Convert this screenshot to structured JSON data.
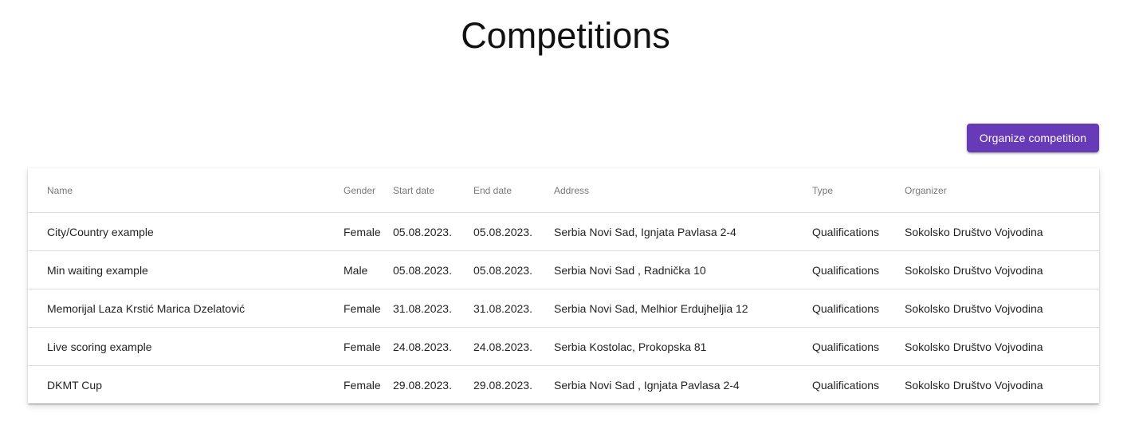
{
  "page": {
    "title": "Competitions"
  },
  "actions": {
    "organize_label": "Organize competition"
  },
  "colors": {
    "primary": "#673ab7"
  },
  "table": {
    "headers": {
      "name": "Name",
      "gender": "Gender",
      "start_date": "Start date",
      "end_date": "End date",
      "address": "Address",
      "type": "Type",
      "organizer": "Organizer"
    },
    "rows": [
      {
        "name": "City/Country example",
        "gender": "Female",
        "start_date": "05.08.2023.",
        "end_date": "05.08.2023.",
        "address": "Serbia Novi Sad, Ignjata Pavlasa 2-4",
        "type": "Qualifications",
        "organizer": "Sokolsko Društvo Vojvodina"
      },
      {
        "name": "Min waiting example",
        "gender": "Male",
        "start_date": "05.08.2023.",
        "end_date": "05.08.2023.",
        "address": "Serbia Novi Sad , Radnička 10",
        "type": "Qualifications",
        "organizer": "Sokolsko Društvo Vojvodina"
      },
      {
        "name": "Memorijal Laza Krstić Marica Dzelatović",
        "gender": "Female",
        "start_date": "31.08.2023.",
        "end_date": "31.08.2023.",
        "address": "Serbia Novi Sad, Melhior Erdujheljia 12",
        "type": "Qualifications",
        "organizer": "Sokolsko Društvo Vojvodina"
      },
      {
        "name": "Live scoring example",
        "gender": "Female",
        "start_date": "24.08.2023.",
        "end_date": "24.08.2023.",
        "address": "Serbia Kostolac, Prokopska 81",
        "type": "Qualifications",
        "organizer": "Sokolsko Društvo Vojvodina"
      },
      {
        "name": "DKMT Cup",
        "gender": "Female",
        "start_date": "29.08.2023.",
        "end_date": "29.08.2023.",
        "address": "Serbia Novi Sad , Ignjata Pavlasa 2-4",
        "type": "Qualifications",
        "organizer": "Sokolsko Društvo Vojvodina"
      }
    ]
  }
}
